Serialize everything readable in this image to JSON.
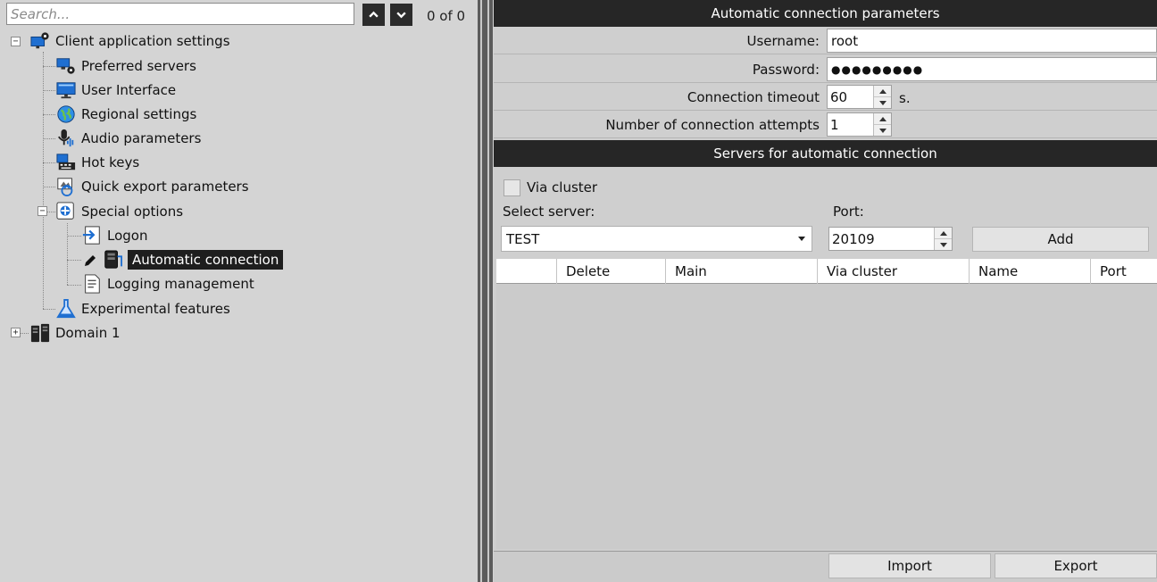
{
  "search": {
    "placeholder": "Search...",
    "value": "",
    "count": "0 of 0"
  },
  "tree": {
    "root": {
      "label": "Client application settings",
      "children": [
        {
          "label": "Preferred servers",
          "icon": "preferred-servers-icon"
        },
        {
          "label": "User Interface",
          "icon": "monitor-icon"
        },
        {
          "label": "Regional settings",
          "icon": "globe-icon"
        },
        {
          "label": "Audio parameters",
          "icon": "microphone-icon"
        },
        {
          "label": "Hot keys",
          "icon": "keyboard-icon"
        },
        {
          "label": "Quick export parameters",
          "icon": "export-icon"
        },
        {
          "label": "Special options",
          "icon": "special-options-icon",
          "children": [
            {
              "label": "Logon",
              "icon": "logon-icon"
            },
            {
              "label": "Automatic connection",
              "icon": "server-icon",
              "selected": true
            },
            {
              "label": "Logging management",
              "icon": "log-document-icon"
            }
          ]
        },
        {
          "label": "Experimental features",
          "icon": "flask-icon"
        }
      ]
    },
    "domain": {
      "label": "Domain 1",
      "icon": "server-rack-icon"
    }
  },
  "auto_params": {
    "header": "Automatic connection parameters",
    "username_label": "Username:",
    "username_value": "root",
    "password_label": "Password:",
    "password_value": "●●●●●●●●●",
    "timeout_label": "Connection timeout",
    "timeout_value": "60",
    "timeout_unit": "s.",
    "attempts_label": "Number of connection attempts",
    "attempts_value": "1"
  },
  "servers": {
    "header": "Servers for automatic connection",
    "via_cluster_label": "Via cluster",
    "via_cluster_checked": false,
    "select_server_label": "Select server:",
    "select_server_value": "TEST",
    "port_label": "Port:",
    "port_value": "20109",
    "add_label": "Add",
    "columns": [
      "",
      "Delete",
      "Main",
      "Via cluster",
      "Name",
      "Port"
    ]
  },
  "footer": {
    "import_label": "Import",
    "export_label": "Export"
  },
  "colors": {
    "header_bg": "#262626",
    "selection_bg": "#1e1e1e",
    "panel_bg": "#d4d4d4"
  }
}
